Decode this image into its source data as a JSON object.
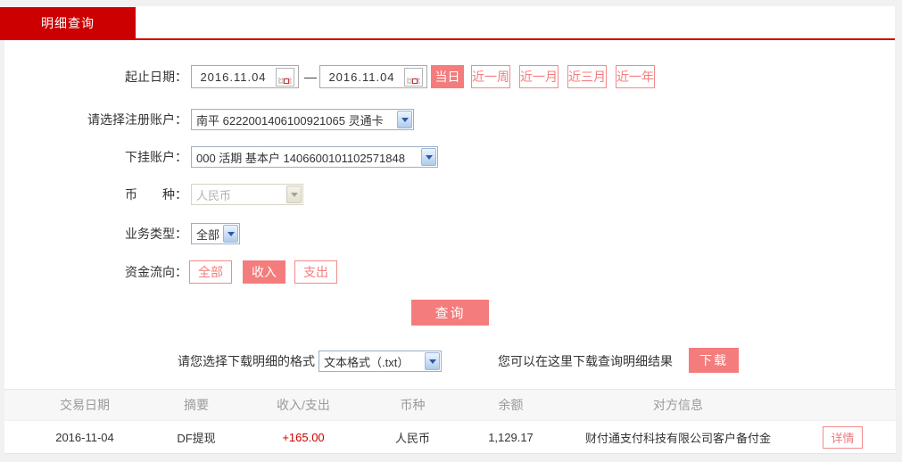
{
  "colors": {
    "brand_red": "#cc0000",
    "accent_salmon": "#f47c7c",
    "income_red": "#cc0000"
  },
  "tab": {
    "title": "明细查询"
  },
  "form": {
    "date_range": {
      "label": "起止日期：",
      "start": "2016.11.04",
      "end": "2016.11.04",
      "separator": "—"
    },
    "quick_ranges": [
      {
        "label": "当日"
      },
      {
        "label": "近一周"
      },
      {
        "label": "近一月"
      },
      {
        "label": "近三月"
      },
      {
        "label": "近一年"
      }
    ],
    "register_account": {
      "label": "请选择注册账户：",
      "value": "南平 6222001406100921065 灵通卡"
    },
    "linked_account": {
      "label": "下挂账户：",
      "value": "000 活期 基本户 1406600101102571848"
    },
    "currency": {
      "label": "币　　种：",
      "value": "人民币"
    },
    "business_type": {
      "label": "业务类型：",
      "value": "全部"
    },
    "fund_flow": {
      "label": "资金流向：",
      "options": [
        {
          "label": "全部"
        },
        {
          "label": "收入"
        },
        {
          "label": "支出"
        }
      ]
    },
    "query_button": "查询"
  },
  "download": {
    "format_label": "请您选择下载明细的格式",
    "format_value": "文本格式（.txt）",
    "hint": "您可以在这里下载查询明细结果",
    "button": "下载"
  },
  "table": {
    "headers": [
      "交易日期",
      "摘要",
      "收入/支出",
      "币种",
      "余额",
      "对方信息"
    ],
    "rows": [
      {
        "date": "2016-11-04",
        "summary": "DF提现",
        "amount": "+165.00",
        "currency": "人民币",
        "balance": "1,129.17",
        "counterparty": "财付通支付科技有限公司客户备付金",
        "action": "详情"
      }
    ]
  }
}
